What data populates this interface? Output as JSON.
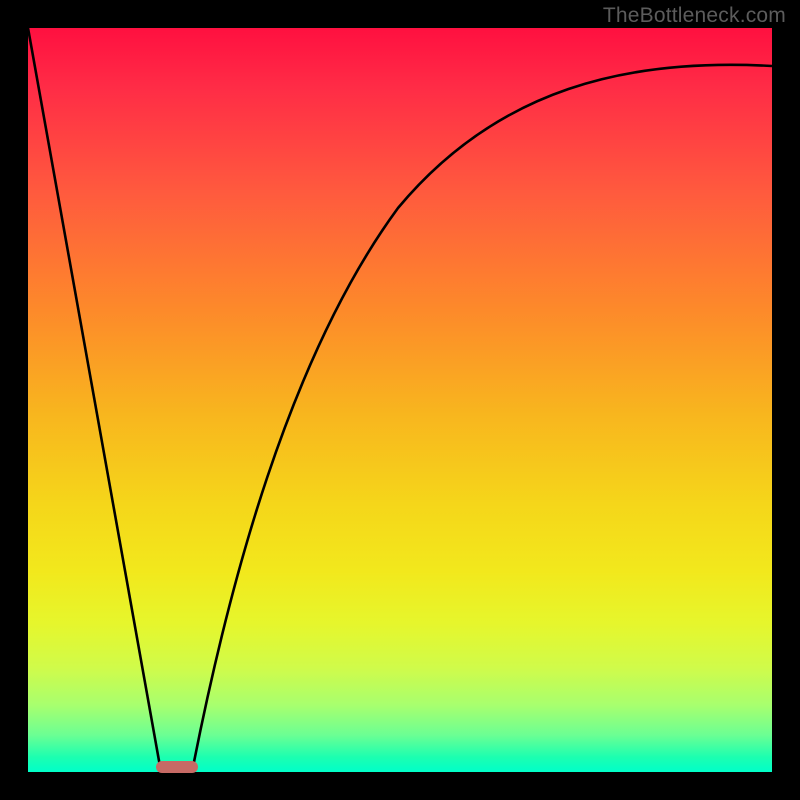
{
  "watermark": {
    "text": "TheBottleneck.com"
  },
  "chart_data": {
    "type": "line",
    "title": "",
    "xlabel": "",
    "ylabel": "",
    "xlim": [
      0,
      100
    ],
    "ylim": [
      0,
      100
    ],
    "grid": false,
    "legend": false,
    "series": [
      {
        "name": "left-segment",
        "x": [
          0,
          18
        ],
        "values": [
          100,
          0
        ]
      },
      {
        "name": "right-curve",
        "x": [
          22,
          25,
          30,
          35,
          40,
          45,
          50,
          55,
          60,
          65,
          70,
          75,
          80,
          85,
          90,
          95,
          100
        ],
        "values": [
          0,
          16,
          36,
          51,
          62,
          70,
          76,
          81,
          85,
          88,
          90,
          91.5,
          92.5,
          93.2,
          93.7,
          94.1,
          94.5
        ]
      }
    ],
    "marker": {
      "x": 20,
      "y": 0,
      "width_pct": 5,
      "color": "#c76a65"
    }
  },
  "colors": {
    "background_frame": "#000000",
    "curve_stroke": "#000000",
    "marker_fill": "#c76a65",
    "watermark_text": "#5c5c5c"
  }
}
